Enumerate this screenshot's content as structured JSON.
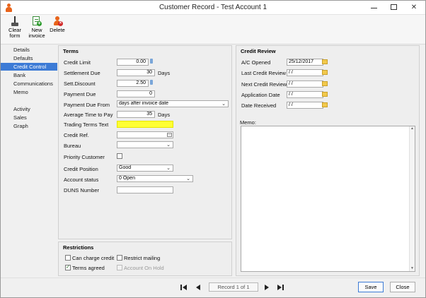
{
  "window": {
    "title": "Customer Record - Test Account 1",
    "min_icon": "minimize-icon",
    "max_icon": "maximize-icon",
    "close_glyph": "✕"
  },
  "ribbon": {
    "clear_label": "Clear\nform",
    "new_invoice_label": "New\ninvoice",
    "delete_label": "Delete"
  },
  "sidebar": {
    "items": [
      "Details",
      "Defaults",
      "Credit Control",
      "Bank",
      "Communications",
      "Memo"
    ],
    "items2": [
      "Activity",
      "Sales",
      "Graph"
    ],
    "active": "Credit Control"
  },
  "terms": {
    "title": "Terms",
    "credit_limit_label": "Credit Limit",
    "credit_limit_value": "0.00",
    "settlement_due_label": "Settlement Due",
    "settlement_due_value": "30",
    "days_label_1": "Days",
    "sett_discount_label": "Sett.Discount",
    "sett_discount_value": "2.50",
    "payment_due_label": "Payment Due",
    "payment_due_value": "0",
    "payment_due_from_label": "Payment Due From",
    "payment_due_from_value": "days after invoice date",
    "avg_time_label": "Average Time to Pay",
    "avg_time_value": "35",
    "days_label_2": "Days",
    "trading_terms_label": "Trading Terms Text",
    "trading_terms_value": "",
    "credit_ref_label": "Credit Ref.",
    "credit_ref_value": "",
    "bureau_label": "Bureau",
    "bureau_value": "",
    "priority_label": "Priority Customer",
    "credit_position_label": "Credit Position",
    "credit_position_value": "Good",
    "account_status_label": "Account status",
    "account_status_value": "0 Open",
    "duns_label": "DUNS Number",
    "duns_value": ""
  },
  "credit_review": {
    "title": "Credit Review",
    "ac_opened_label": "A/C Opened",
    "ac_opened_value": "25/12/2017",
    "last_review_label": "Last Credit Review",
    "last_review_value": " / /",
    "next_review_label": "Next Credit Review",
    "next_review_value": " / /",
    "application_date_label": "Application Date",
    "application_date_value": " / /",
    "date_received_label": "Date Received",
    "date_received_value": " / /",
    "memo_label": "Memo:"
  },
  "restrictions": {
    "title": "Restrictions",
    "can_charge_credit_label": "Can charge credit",
    "restrict_mailing_label": "Restrict mailing",
    "terms_agreed_label": "Terms agreed",
    "account_on_hold_label": "Account On Hold",
    "check_glyph": "✓"
  },
  "footer": {
    "record_text": "Record 1 of 1",
    "save_label": "Save",
    "close_label": "Close"
  }
}
